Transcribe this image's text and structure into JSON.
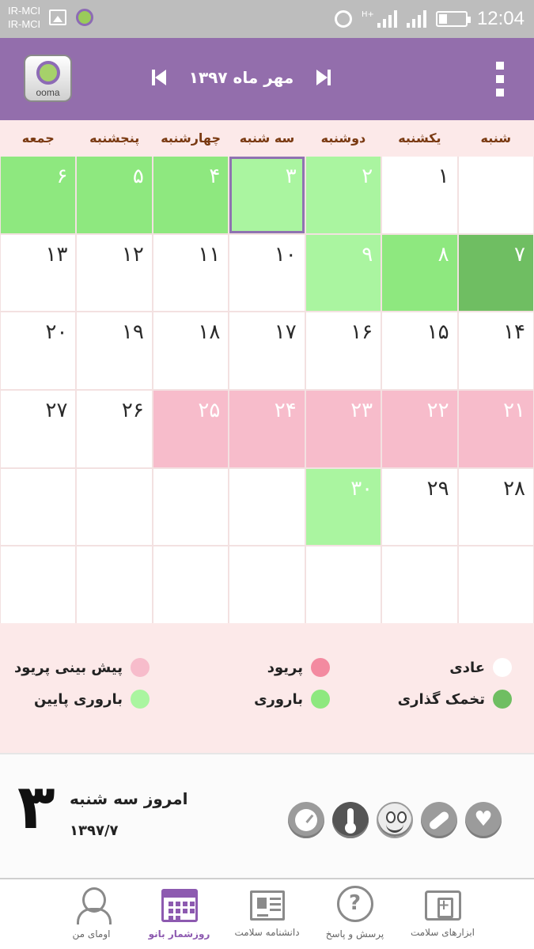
{
  "status_bar": {
    "carrier_1": "IR-MCI",
    "carrier_2": "IR-MCI",
    "network": "H+",
    "time": "12:04"
  },
  "app_bar": {
    "logo_text": "ooma",
    "month_title": "مهر ماه ۱۳۹۷"
  },
  "weekdays": [
    "شنبه",
    "یکشنبه",
    "دوشنبه",
    "سه شنبه",
    "چهارشنبه",
    "پنجشنبه",
    "جمعه"
  ],
  "calendar": {
    "rows": [
      [
        {
          "n": "",
          "s": "normal"
        },
        {
          "n": "۱",
          "s": "normal"
        },
        {
          "n": "۲",
          "s": "lowfert"
        },
        {
          "n": "۳",
          "s": "today"
        },
        {
          "n": "۴",
          "s": "fertile"
        },
        {
          "n": "۵",
          "s": "fertile"
        },
        {
          "n": "۶",
          "s": "fertile"
        }
      ],
      [
        {
          "n": "۷",
          "s": "ovul"
        },
        {
          "n": "۸",
          "s": "fertile"
        },
        {
          "n": "۹",
          "s": "lowfert"
        },
        {
          "n": "۱۰",
          "s": "normal"
        },
        {
          "n": "۱۱",
          "s": "normal"
        },
        {
          "n": "۱۲",
          "s": "normal"
        },
        {
          "n": "۱۳",
          "s": "normal"
        }
      ],
      [
        {
          "n": "۱۴",
          "s": "normal"
        },
        {
          "n": "۱۵",
          "s": "normal"
        },
        {
          "n": "۱۶",
          "s": "normal"
        },
        {
          "n": "۱۷",
          "s": "normal"
        },
        {
          "n": "۱۸",
          "s": "normal"
        },
        {
          "n": "۱۹",
          "s": "normal"
        },
        {
          "n": "۲۰",
          "s": "normal"
        }
      ],
      [
        {
          "n": "۲۱",
          "s": "period"
        },
        {
          "n": "۲۲",
          "s": "period"
        },
        {
          "n": "۲۳",
          "s": "period"
        },
        {
          "n": "۲۴",
          "s": "period"
        },
        {
          "n": "۲۵",
          "s": "period"
        },
        {
          "n": "۲۶",
          "s": "normal"
        },
        {
          "n": "۲۷",
          "s": "normal"
        }
      ],
      [
        {
          "n": "۲۸",
          "s": "normal"
        },
        {
          "n": "۲۹",
          "s": "normal"
        },
        {
          "n": "۳۰",
          "s": "lowfert"
        },
        {
          "n": "",
          "s": "normal"
        },
        {
          "n": "",
          "s": "normal"
        },
        {
          "n": "",
          "s": "normal"
        },
        {
          "n": "",
          "s": "normal"
        }
      ],
      [
        {
          "n": "",
          "s": "normal"
        },
        {
          "n": "",
          "s": "normal"
        },
        {
          "n": "",
          "s": "normal"
        },
        {
          "n": "",
          "s": "normal"
        },
        {
          "n": "",
          "s": "normal"
        },
        {
          "n": "",
          "s": "normal"
        },
        {
          "n": "",
          "s": "normal"
        }
      ]
    ]
  },
  "legend": {
    "normal": {
      "label": "عادی",
      "color": "#ffffff"
    },
    "period": {
      "label": "پریود",
      "color": "#f38aa0"
    },
    "predicted": {
      "label": "پیش بینی پریود",
      "color": "#f7bccb"
    },
    "ovulation": {
      "label": "تخمک گذاری",
      "color": "#6fbe62"
    },
    "fertile": {
      "label": "باروری",
      "color": "#8ee87f"
    },
    "low_fertility": {
      "label": "باروری پایین",
      "color": "#aaf5a0"
    }
  },
  "today": {
    "day_big": "۳",
    "title": "امروز سه شنبه",
    "date": "۱۳۹۷/۷"
  },
  "tools": [
    "weight-scale-icon",
    "thermometer-icon",
    "mood-icon",
    "pill-icon",
    "heart-icon"
  ],
  "bottom_nav": {
    "tools": "ابزارهای سلامت",
    "qa": "پرسش و پاسخ",
    "encyclopedia": "دانشنامه سلامت",
    "calendar": "روزشمار بانو",
    "profile": "اومای من"
  },
  "colors": {
    "accent": "#936eac",
    "today_border": "#8f73b1",
    "calendar_bg": "#fce9e9"
  }
}
